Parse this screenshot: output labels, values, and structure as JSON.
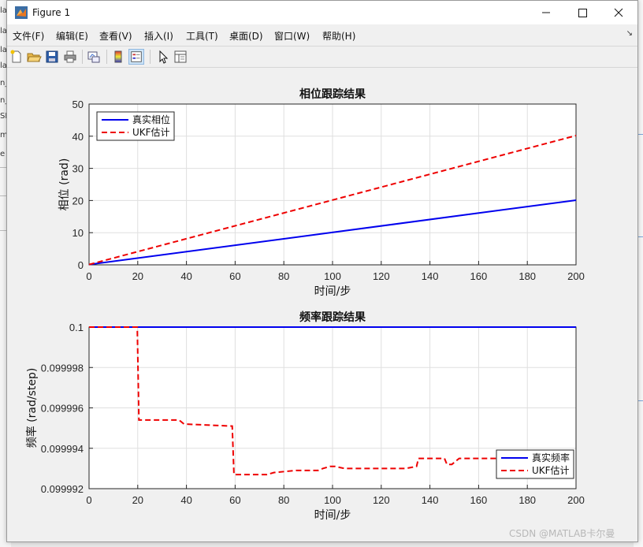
{
  "window": {
    "title": "Figure 1"
  },
  "menu": [
    "文件(F)",
    "编辑(E)",
    "查看(V)",
    "插入(I)",
    "工具(T)",
    "桌面(D)",
    "窗口(W)",
    "帮助(H)"
  ],
  "toolbar": [
    "new-figure",
    "open-file",
    "save",
    "print",
    "link-plot",
    "insert-colorbar",
    "insert-legend",
    "edit-plot",
    "property-inspector"
  ],
  "background_fragments": [
    "la",
    "la",
    "la",
    "la",
    "n_",
    "n_",
    "SI",
    "m",
    "e"
  ],
  "watermark": "CSDN @MATLAB卡尔曼",
  "colors": {
    "true_series": "#0000ee",
    "estimate_series": "#ee0000"
  },
  "chart_data": [
    {
      "type": "line",
      "title": "相位跟踪结果",
      "xlabel": "时间/步",
      "ylabel": "相位 (rad)",
      "xlim": [
        0,
        200
      ],
      "ylim": [
        0,
        50
      ],
      "xticks": [
        "0",
        "20",
        "40",
        "60",
        "80",
        "100",
        "120",
        "140",
        "160",
        "180",
        "200"
      ],
      "yticks": [
        "0",
        "10",
        "20",
        "30",
        "40",
        "50"
      ],
      "grid": true,
      "legend_position": "top-left",
      "series": [
        {
          "name": "真实相位",
          "style": "solid",
          "x": [
            0,
            200
          ],
          "y": [
            0.1,
            20.1
          ]
        },
        {
          "name": "UKF估计",
          "style": "dashed",
          "x": [
            0,
            200
          ],
          "y": [
            0.1,
            40.2
          ]
        }
      ]
    },
    {
      "type": "line",
      "title": "频率跟踪结果",
      "xlabel": "时间/步",
      "ylabel": "频率 (rad/step)",
      "xlim": [
        0,
        200
      ],
      "ylim": [
        0.099992,
        0.1
      ],
      "xticks": [
        "0",
        "20",
        "40",
        "60",
        "80",
        "100",
        "120",
        "140",
        "160",
        "180",
        "200"
      ],
      "yticks": [
        "0.099992",
        "0.099994",
        "0.099996",
        "0.099998",
        "0.1"
      ],
      "grid": true,
      "legend_position": "bottom-right",
      "series": [
        {
          "name": "真实频率",
          "style": "solid",
          "x": [
            0,
            200
          ],
          "y": [
            0.1,
            0.1
          ]
        },
        {
          "name": "UKF估计",
          "style": "dashed",
          "x": [
            0,
            19.8,
            20.5,
            37,
            39,
            58.8,
            59.5,
            73,
            76,
            85,
            94,
            96,
            99,
            101,
            105,
            110,
            120,
            127,
            130,
            134.5,
            135.3,
            146,
            147,
            149,
            152,
            160,
            170,
            180,
            188,
            196,
            200
          ],
          "y": [
            0.1,
            0.1,
            0.0999954,
            0.0999954,
            0.0999952,
            0.0999951,
            0.0999927,
            0.0999927,
            0.0999928,
            0.0999929,
            0.0999929,
            0.099993,
            0.0999931,
            0.0999931,
            0.099993,
            0.099993,
            0.099993,
            0.099993,
            0.099993,
            0.0999931,
            0.0999935,
            0.0999935,
            0.0999932,
            0.0999932,
            0.0999935,
            0.0999935,
            0.0999935,
            0.0999936,
            0.0999934,
            0.0999932,
            0.0999932
          ]
        }
      ]
    }
  ]
}
